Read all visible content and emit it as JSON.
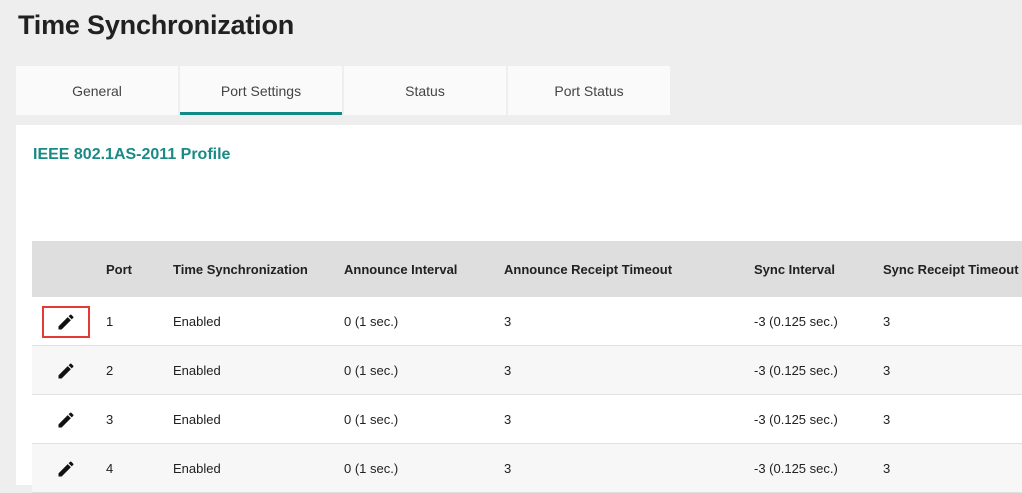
{
  "page": {
    "title": "Time Synchronization"
  },
  "tabs": [
    {
      "label": "General",
      "active": false
    },
    {
      "label": "Port Settings",
      "active": true
    },
    {
      "label": "Status",
      "active": false
    },
    {
      "label": "Port Status",
      "active": false
    }
  ],
  "section": {
    "title": "IEEE 802.1AS-2011 Profile"
  },
  "table": {
    "columns": [
      "",
      "Port",
      "Time Synchronization",
      "Announce Interval",
      "Announce Receipt Timeout",
      "Sync Interval",
      "Sync Receipt Timeout"
    ],
    "rows": [
      {
        "port": "1",
        "time_sync": "Enabled",
        "announce_interval": "0 (1 sec.)",
        "announce_receipt_timeout": "3",
        "sync_interval": "-3 (0.125 sec.)",
        "sync_receipt_timeout": "3",
        "edit_icon": "pencil-icon",
        "highlighted": true
      },
      {
        "port": "2",
        "time_sync": "Enabled",
        "announce_interval": "0 (1 sec.)",
        "announce_receipt_timeout": "3",
        "sync_interval": "-3 (0.125 sec.)",
        "sync_receipt_timeout": "3",
        "edit_icon": "pencil-icon",
        "highlighted": false
      },
      {
        "port": "3",
        "time_sync": "Enabled",
        "announce_interval": "0 (1 sec.)",
        "announce_receipt_timeout": "3",
        "sync_interval": "-3 (0.125 sec.)",
        "sync_receipt_timeout": "3",
        "edit_icon": "pencil-icon",
        "highlighted": false
      },
      {
        "port": "4",
        "time_sync": "Enabled",
        "announce_interval": "0 (1 sec.)",
        "announce_receipt_timeout": "3",
        "sync_interval": "-3 (0.125 sec.)",
        "sync_receipt_timeout": "3",
        "edit_icon": "pencil-icon",
        "highlighted": false
      }
    ]
  },
  "colors": {
    "accent": "#0f8a84",
    "section_title": "#1a8a85",
    "highlight_border": "#e53935",
    "header_background": "#dedede",
    "page_background": "#eeeeee"
  }
}
